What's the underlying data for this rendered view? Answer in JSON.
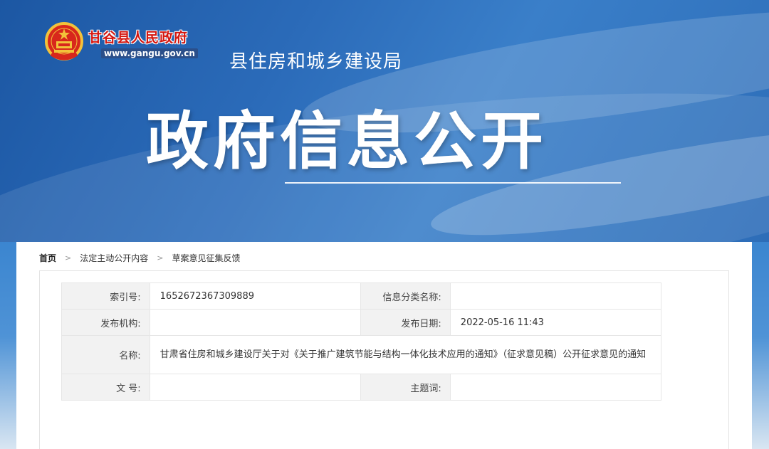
{
  "header": {
    "site_name": "甘谷县人民政府",
    "site_url": "www.gangu.gov.cn",
    "department": "县住房和城乡建设局",
    "banner_title": "政府信息公开"
  },
  "breadcrumb": {
    "home": "首页",
    "level1": "法定主动公开内容",
    "level2": "草案意见征集反馈",
    "separator": ">"
  },
  "meta": {
    "index_label": "索引号:",
    "index_value": "1652672367309889",
    "category_label": "信息分类名称:",
    "category_value": "",
    "publisher_label": "发布机构:",
    "publisher_value": "",
    "date_label": "发布日期:",
    "date_value": "2022-05-16 11:43",
    "name_label": "名称:",
    "name_value": "甘肃省住房和城乡建设厅关于对《关于推广建筑节能与结构一体化技术应用的通知》（征求意见稿）公开征求意见的通知",
    "docno_label": "文 号:",
    "docno_value": "",
    "keyword_label": "主题词:",
    "keyword_value": ""
  },
  "colors": {
    "banner_blue": "#2b6bb9",
    "site_name_red": "#d4160f",
    "label_bg": "#f2f2f2"
  }
}
